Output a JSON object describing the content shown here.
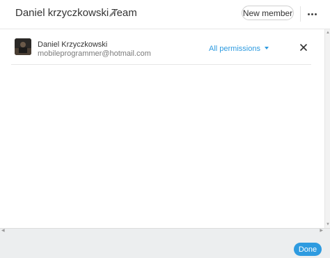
{
  "header": {
    "team_title": "Daniel krzyczkowski Team",
    "new_member_label": "New member"
  },
  "members": [
    {
      "name": "Daniel Krzyczkowski",
      "email": "mobileprogrammer@hotmail.com",
      "permissions_label": "All permissions"
    }
  ],
  "footer": {
    "done_label": "Done"
  },
  "colors": {
    "accent": "#2e9be0",
    "footer_bg": "#eceeef",
    "divider": "#e6e6e6"
  },
  "icons": {
    "edit": "pencil-icon",
    "more": "more-dots-icon",
    "remove": "close-icon",
    "permissions_dropdown": "caret-down-icon"
  }
}
